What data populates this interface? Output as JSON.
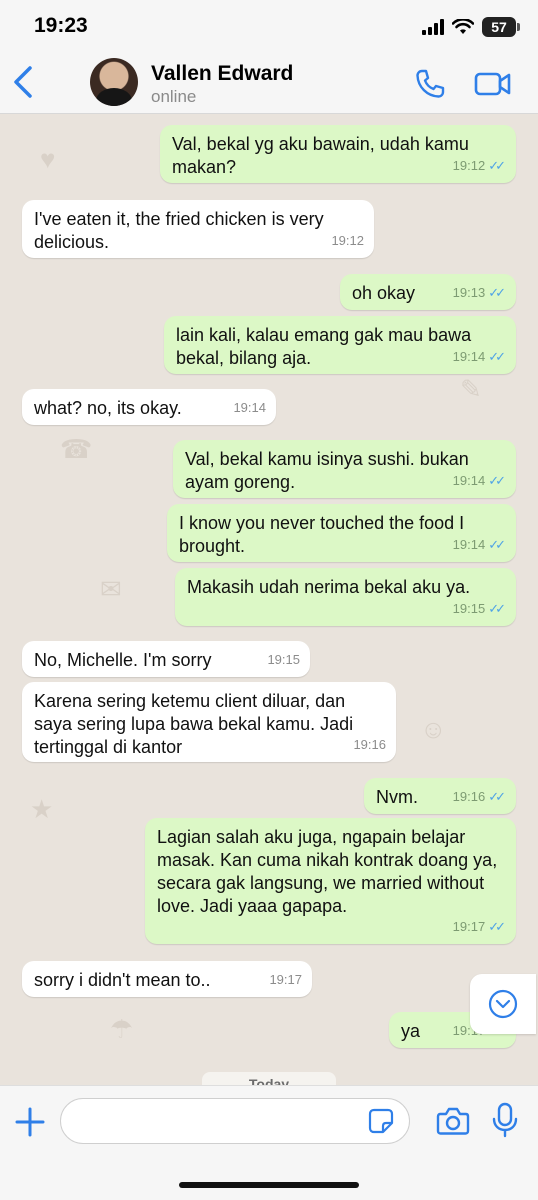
{
  "status_bar": {
    "time": "19:23",
    "battery": "57"
  },
  "header": {
    "contact_name": "Vallen Edward",
    "status": "online"
  },
  "messages": [
    {
      "dir": "out",
      "text": "Val, bekal yg aku bawain, udah kamu makan?",
      "time": "19:12"
    },
    {
      "dir": "in",
      "text": "I've eaten it, the fried chicken is very delicious.",
      "time": "19:12"
    },
    {
      "dir": "out",
      "text": "oh okay",
      "time": "19:13"
    },
    {
      "dir": "out",
      "text": "lain kali, kalau emang gak mau bawa bekal, bilang aja.",
      "time": "19:14"
    },
    {
      "dir": "in",
      "text": "what? no, its okay.",
      "time": "19:14"
    },
    {
      "dir": "out",
      "text": "Val, bekal kamu isinya sushi. bukan ayam goreng.",
      "time": "19:14"
    },
    {
      "dir": "out",
      "text": "I know you never touched the food I brought.",
      "time": "19:14"
    },
    {
      "dir": "out",
      "text": "Makasih udah nerima bekal aku ya.",
      "time": "19:15"
    },
    {
      "dir": "in",
      "text": "No, Michelle. I'm sorry",
      "time": "19:15"
    },
    {
      "dir": "in",
      "text": "Karena sering ketemu client diluar, dan saya sering lupa bawa bekal kamu. Jadi tertinggal di kantor",
      "time": "19:16"
    },
    {
      "dir": "out",
      "text": "Nvm.",
      "time": "19:16"
    },
    {
      "dir": "out",
      "text": "Lagian salah aku juga, ngapain belajar masak. Kan cuma nikah kontrak doang ya, secara gak langsung, we married without love. Jadi yaaa gapapa.",
      "time": "19:17"
    },
    {
      "dir": "in",
      "text": "sorry i didn't mean to..",
      "time": "19:17"
    },
    {
      "dir": "out",
      "text": "ya",
      "time": "19:17"
    }
  ],
  "date_divider": "Today",
  "input": {
    "value": "",
    "placeholder": ""
  },
  "colors": {
    "outgoing_bubble": "#dcf8c6",
    "incoming_bubble": "#ffffff",
    "accent": "#2f7fe8",
    "read_ticks": "#4fa3e6"
  }
}
